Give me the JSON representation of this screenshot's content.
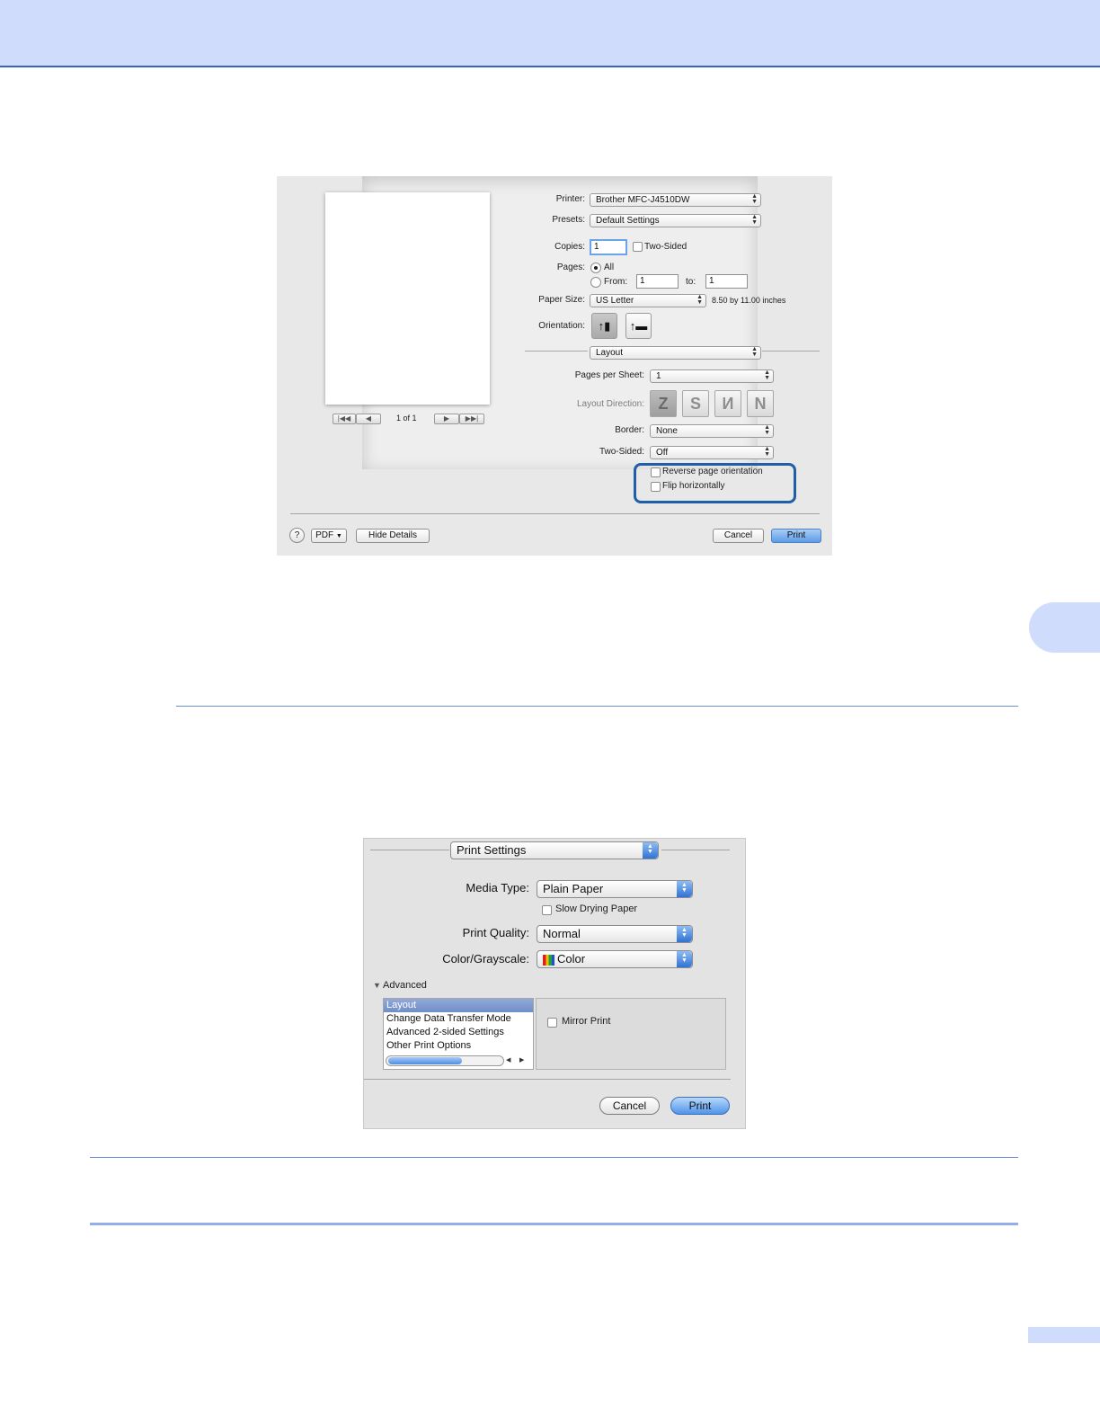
{
  "dialog1": {
    "printer_label": "Printer:",
    "printer_value": "Brother MFC-J4510DW",
    "presets_label": "Presets:",
    "presets_value": "Default Settings",
    "copies_label": "Copies:",
    "copies_value": "1",
    "two_sided_check": "Two-Sided",
    "pages_label": "Pages:",
    "pages_all": "All",
    "pages_from": "From:",
    "pages_from_value": "1",
    "pages_to": "to:",
    "pages_to_value": "1",
    "paper_size_label": "Paper Size:",
    "paper_size_value": "US Letter",
    "paper_dims": "8.50 by 11.00 inches",
    "orientation_label": "Orientation:",
    "section_popup": "Layout",
    "pps_label": "Pages per Sheet:",
    "pps_value": "1",
    "layout_dir_label": "Layout Direction:",
    "border_label": "Border:",
    "border_value": "None",
    "two_sided_label": "Two-Sided:",
    "two_sided_value": "Off",
    "reverse_label": "Reverse page orientation",
    "flip_label": "Flip horizontally",
    "page_counter": "1 of 1",
    "help_glyph": "?",
    "pdf_button": "PDF",
    "hide_details_button": "Hide Details",
    "cancel_button": "Cancel",
    "print_button": "Print"
  },
  "dialog2": {
    "section_popup": "Print Settings",
    "media_type_label": "Media Type:",
    "media_type_value": "Plain Paper",
    "slow_drying_label": "Slow Drying Paper",
    "print_quality_label": "Print Quality:",
    "print_quality_value": "Normal",
    "color_label": "Color/Grayscale:",
    "color_value": "Color",
    "advanced_label": "Advanced",
    "list_items": [
      "Layout",
      "Change Data Transfer Mode",
      "Advanced 2-sided Settings",
      "Other Print Options"
    ],
    "mirror_print_label": "Mirror Print",
    "cancel_button": "Cancel",
    "print_button": "Print"
  },
  "colors": {
    "header_band": "#cfdcfb",
    "rule_blue": "#6d8fd6",
    "highlight_box": "#1f5fa8",
    "default_button": "#5d9be6"
  }
}
